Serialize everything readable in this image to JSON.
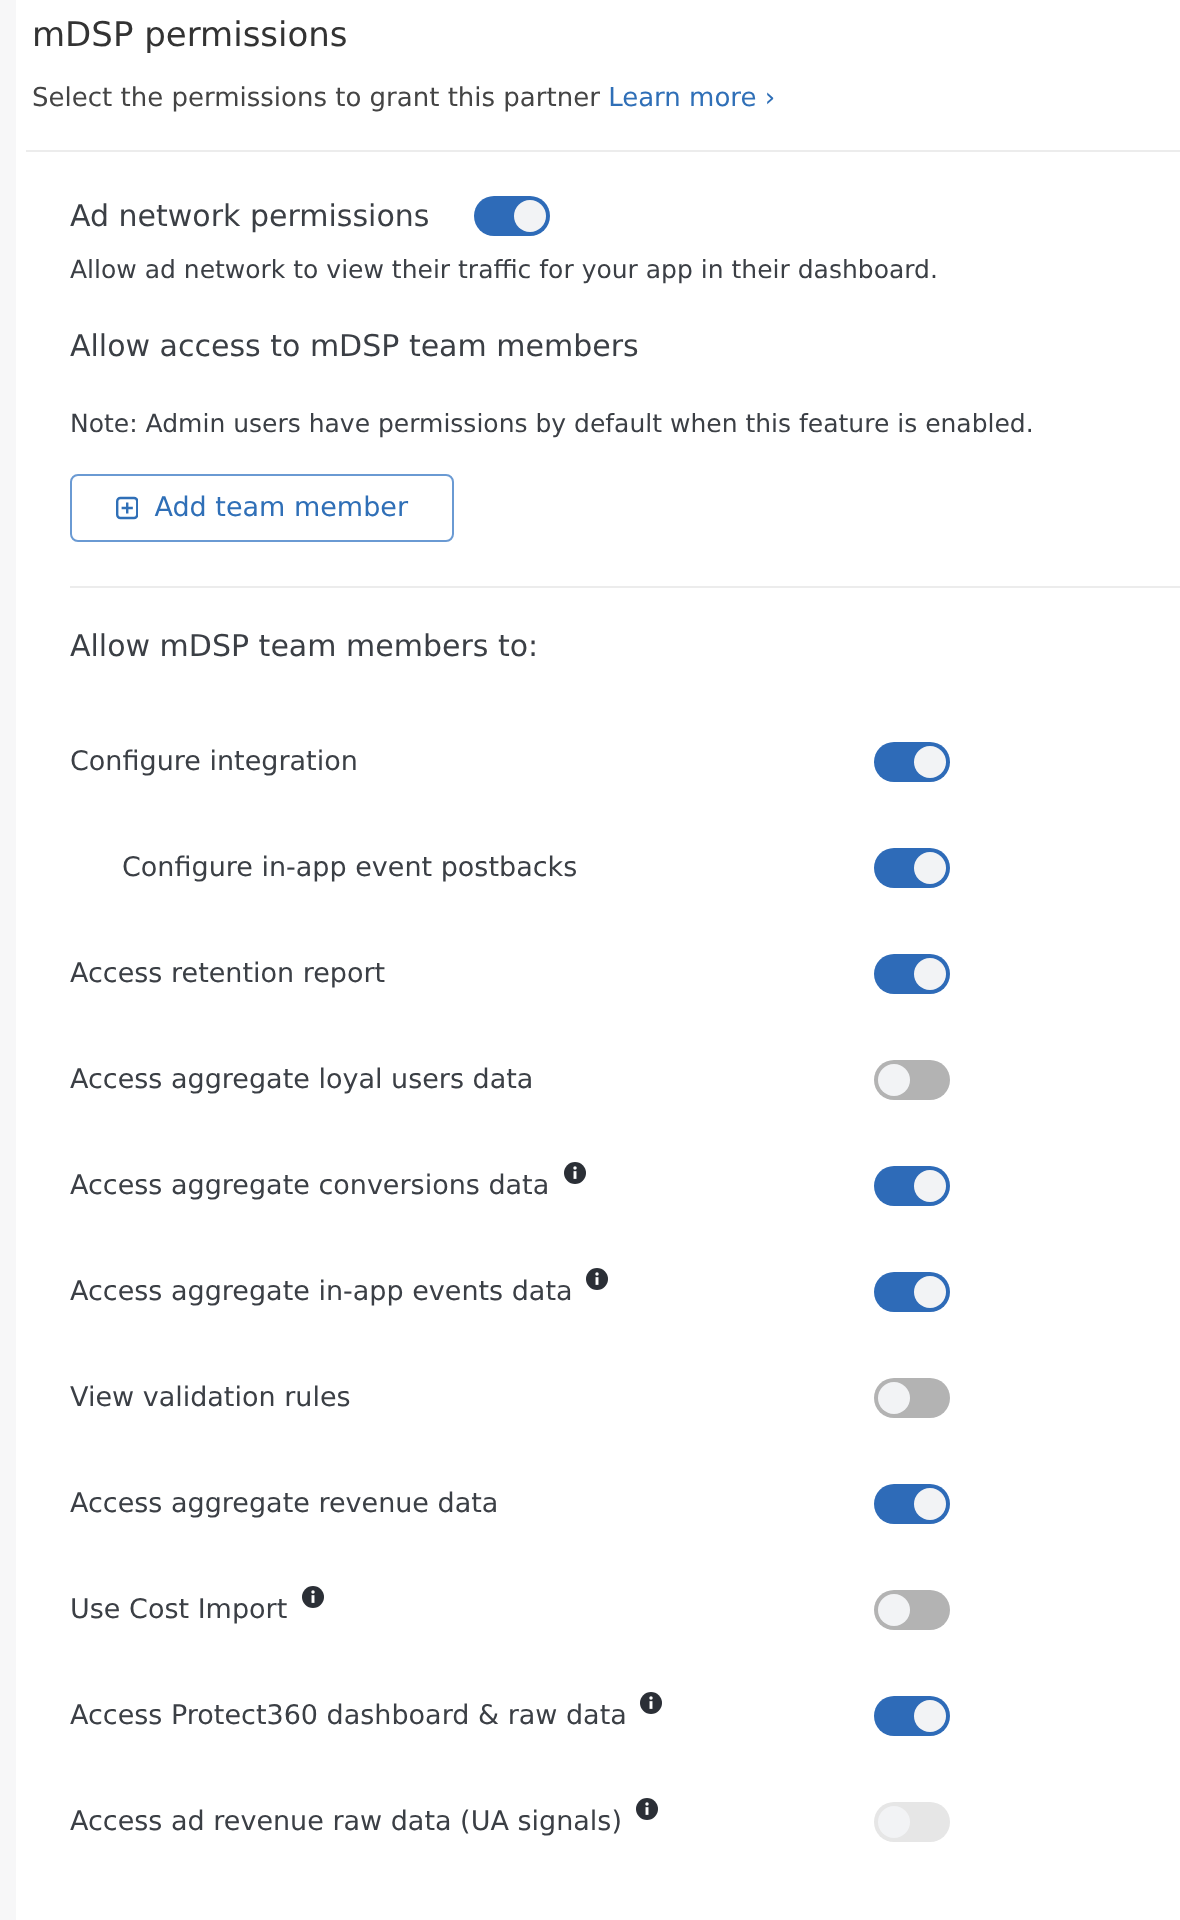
{
  "header": {
    "title": "mDSP permissions",
    "subtitle": "Select the permissions to grant this partner",
    "learn_more": "Learn more ›"
  },
  "ad_network": {
    "label": "Ad network permissions",
    "on": true,
    "description": "Allow ad network to view their traffic for your app in their dashboard."
  },
  "team_access": {
    "heading": "Allow access to mDSP team members",
    "note": "Note: Admin users have permissions by default when this feature is enabled.",
    "add_button": "Add team member"
  },
  "permissions_heading": "Allow mDSP team members to:",
  "permissions": [
    {
      "label": "Configure integration",
      "on": true,
      "disabled": false,
      "info": false,
      "children": [
        {
          "label": "Configure in-app event postbacks",
          "on": true,
          "disabled": false,
          "info": false
        }
      ]
    },
    {
      "label": "Access retention report",
      "on": true,
      "disabled": false,
      "info": false
    },
    {
      "label": "Access aggregate loyal users data",
      "on": false,
      "disabled": false,
      "info": false
    },
    {
      "label": "Access aggregate conversions data",
      "on": true,
      "disabled": false,
      "info": true
    },
    {
      "label": "Access aggregate in-app events data",
      "on": true,
      "disabled": false,
      "info": true
    },
    {
      "label": "View validation rules",
      "on": false,
      "disabled": false,
      "info": false
    },
    {
      "label": "Access aggregate revenue data",
      "on": true,
      "disabled": false,
      "info": false
    },
    {
      "label": "Use Cost Import",
      "on": false,
      "disabled": false,
      "info": true
    },
    {
      "label": "Access Protect360 dashboard & raw data",
      "on": true,
      "disabled": false,
      "info": true
    },
    {
      "label": "Access ad revenue raw data (UA signals)",
      "on": false,
      "disabled": true,
      "info": true
    }
  ]
}
